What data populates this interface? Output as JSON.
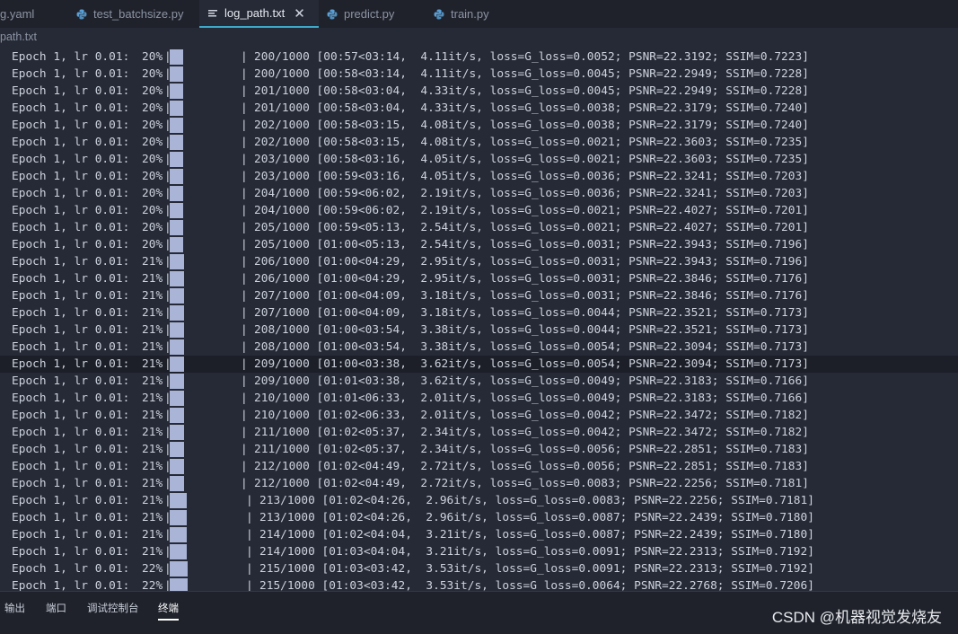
{
  "tabs": [
    {
      "label": "g.yaml",
      "icon": "none",
      "active": false
    },
    {
      "label": "test_batchsize.py",
      "icon": "python-icon",
      "active": false
    },
    {
      "label": "log_path.txt",
      "icon": "text-file-icon",
      "active": true
    },
    {
      "label": "predict.py",
      "icon": "python-icon",
      "active": false
    },
    {
      "label": "train.py",
      "icon": "python-icon",
      "active": false
    }
  ],
  "breadcrumb": "path.txt",
  "log_lines": [
    {
      "prefix": "Epoch 1, lr 0.01:",
      "pct": "20%",
      "progress": 0.2,
      "rest": "200/1000 [00:57<03:14,  4.11it/s, loss=G_loss=0.0052; PSNR=22.3192; SSIM=0.7223]"
    },
    {
      "prefix": "Epoch 1, lr 0.01:",
      "pct": "20%",
      "progress": 0.2,
      "rest": "200/1000 [00:58<03:14,  4.11it/s, loss=G_loss=0.0045; PSNR=22.2949; SSIM=0.7228]"
    },
    {
      "prefix": "Epoch 1, lr 0.01:",
      "pct": "20%",
      "progress": 0.2,
      "rest": "201/1000 [00:58<03:04,  4.33it/s, loss=G_loss=0.0045; PSNR=22.2949; SSIM=0.7228]"
    },
    {
      "prefix": "Epoch 1, lr 0.01:",
      "pct": "20%",
      "progress": 0.2,
      "rest": "201/1000 [00:58<03:04,  4.33it/s, loss=G_loss=0.0038; PSNR=22.3179; SSIM=0.7240]"
    },
    {
      "prefix": "Epoch 1, lr 0.01:",
      "pct": "20%",
      "progress": 0.2,
      "rest": "202/1000 [00:58<03:15,  4.08it/s, loss=G_loss=0.0038; PSNR=22.3179; SSIM=0.7240]"
    },
    {
      "prefix": "Epoch 1, lr 0.01:",
      "pct": "20%",
      "progress": 0.2,
      "rest": "202/1000 [00:58<03:15,  4.08it/s, loss=G_loss=0.0021; PSNR=22.3603; SSIM=0.7235]"
    },
    {
      "prefix": "Epoch 1, lr 0.01:",
      "pct": "20%",
      "progress": 0.2,
      "rest": "203/1000 [00:58<03:16,  4.05it/s, loss=G_loss=0.0021; PSNR=22.3603; SSIM=0.7235]"
    },
    {
      "prefix": "Epoch 1, lr 0.01:",
      "pct": "20%",
      "progress": 0.2,
      "rest": "203/1000 [00:59<03:16,  4.05it/s, loss=G_loss=0.0036; PSNR=22.3241; SSIM=0.7203]"
    },
    {
      "prefix": "Epoch 1, lr 0.01:",
      "pct": "20%",
      "progress": 0.2,
      "rest": "204/1000 [00:59<06:02,  2.19it/s, loss=G_loss=0.0036; PSNR=22.3241; SSIM=0.7203]"
    },
    {
      "prefix": "Epoch 1, lr 0.01:",
      "pct": "20%",
      "progress": 0.2,
      "rest": "204/1000 [00:59<06:02,  2.19it/s, loss=G_loss=0.0021; PSNR=22.4027; SSIM=0.7201]"
    },
    {
      "prefix": "Epoch 1, lr 0.01:",
      "pct": "20%",
      "progress": 0.2,
      "rest": "205/1000 [00:59<05:13,  2.54it/s, loss=G_loss=0.0021; PSNR=22.4027; SSIM=0.7201]"
    },
    {
      "prefix": "Epoch 1, lr 0.01:",
      "pct": "20%",
      "progress": 0.2,
      "rest": "205/1000 [01:00<05:13,  2.54it/s, loss=G_loss=0.0031; PSNR=22.3943; SSIM=0.7196]"
    },
    {
      "prefix": "Epoch 1, lr 0.01:",
      "pct": "21%",
      "progress": 0.21,
      "rest": "206/1000 [01:00<04:29,  2.95it/s, loss=G_loss=0.0031; PSNR=22.3943; SSIM=0.7196]"
    },
    {
      "prefix": "Epoch 1, lr 0.01:",
      "pct": "21%",
      "progress": 0.21,
      "rest": "206/1000 [01:00<04:29,  2.95it/s, loss=G_loss=0.0031; PSNR=22.3846; SSIM=0.7176]"
    },
    {
      "prefix": "Epoch 1, lr 0.01:",
      "pct": "21%",
      "progress": 0.21,
      "rest": "207/1000 [01:00<04:09,  3.18it/s, loss=G_loss=0.0031; PSNR=22.3846; SSIM=0.7176]"
    },
    {
      "prefix": "Epoch 1, lr 0.01:",
      "pct": "21%",
      "progress": 0.21,
      "rest": "207/1000 [01:00<04:09,  3.18it/s, loss=G_loss=0.0044; PSNR=22.3521; SSIM=0.7173]"
    },
    {
      "prefix": "Epoch 1, lr 0.01:",
      "pct": "21%",
      "progress": 0.21,
      "rest": "208/1000 [01:00<03:54,  3.38it/s, loss=G_loss=0.0044; PSNR=22.3521; SSIM=0.7173]"
    },
    {
      "prefix": "Epoch 1, lr 0.01:",
      "pct": "21%",
      "progress": 0.21,
      "rest": "208/1000 [01:00<03:54,  3.38it/s, loss=G_loss=0.0054; PSNR=22.3094; SSIM=0.7173]"
    },
    {
      "prefix": "Epoch 1, lr 0.01:",
      "pct": "21%",
      "progress": 0.21,
      "rest": "209/1000 [01:00<03:38,  3.62it/s, loss=G_loss=0.0054; PSNR=22.3094; SSIM=0.7173]",
      "current": true
    },
    {
      "prefix": "Epoch 1, lr 0.01:",
      "pct": "21%",
      "progress": 0.21,
      "rest": "209/1000 [01:01<03:38,  3.62it/s, loss=G_loss=0.0049; PSNR=22.3183; SSIM=0.7166]"
    },
    {
      "prefix": "Epoch 1, lr 0.01:",
      "pct": "21%",
      "progress": 0.21,
      "rest": "210/1000 [01:01<06:33,  2.01it/s, loss=G_loss=0.0049; PSNR=22.3183; SSIM=0.7166]"
    },
    {
      "prefix": "Epoch 1, lr 0.01:",
      "pct": "21%",
      "progress": 0.21,
      "rest": "210/1000 [01:02<06:33,  2.01it/s, loss=G_loss=0.0042; PSNR=22.3472; SSIM=0.7182]"
    },
    {
      "prefix": "Epoch 1, lr 0.01:",
      "pct": "21%",
      "progress": 0.21,
      "rest": "211/1000 [01:02<05:37,  2.34it/s, loss=G_loss=0.0042; PSNR=22.3472; SSIM=0.7182]"
    },
    {
      "prefix": "Epoch 1, lr 0.01:",
      "pct": "21%",
      "progress": 0.21,
      "rest": "211/1000 [01:02<05:37,  2.34it/s, loss=G_loss=0.0056; PSNR=22.2851; SSIM=0.7183]"
    },
    {
      "prefix": "Epoch 1, lr 0.01:",
      "pct": "21%",
      "progress": 0.21,
      "rest": "212/1000 [01:02<04:49,  2.72it/s, loss=G_loss=0.0056; PSNR=22.2851; SSIM=0.7183]"
    },
    {
      "prefix": "Epoch 1, lr 0.01:",
      "pct": "21%",
      "progress": 0.21,
      "rest": "212/1000 [01:02<04:49,  2.72it/s, loss=G_loss=0.0083; PSNR=22.2256; SSIM=0.7181]"
    },
    {
      "prefix": "Epoch 1, lr 0.01:",
      "pct": "21%",
      "progress": 0.21,
      "rest": "213/1000 [01:02<04:26,  2.96it/s, loss=G_loss=0.0083; PSNR=22.2256; SSIM=0.7181]",
      "wide": true
    },
    {
      "prefix": "Epoch 1, lr 0.01:",
      "pct": "21%",
      "progress": 0.21,
      "rest": "213/1000 [01:02<04:26,  2.96it/s, loss=G_loss=0.0087; PSNR=22.2439; SSIM=0.7180]",
      "wide": true
    },
    {
      "prefix": "Epoch 1, lr 0.01:",
      "pct": "21%",
      "progress": 0.21,
      "rest": "214/1000 [01:02<04:04,  3.21it/s, loss=G_loss=0.0087; PSNR=22.2439; SSIM=0.7180]",
      "wide": true
    },
    {
      "prefix": "Epoch 1, lr 0.01:",
      "pct": "21%",
      "progress": 0.21,
      "rest": "214/1000 [01:03<04:04,  3.21it/s, loss=G_loss=0.0091; PSNR=22.2313; SSIM=0.7192]",
      "wide": true
    },
    {
      "prefix": "Epoch 1, lr 0.01:",
      "pct": "22%",
      "progress": 0.22,
      "rest": "215/1000 [01:03<03:42,  3.53it/s, loss=G_loss=0.0091; PSNR=22.2313; SSIM=0.7192]",
      "wide": true
    },
    {
      "prefix": "Epoch 1, lr 0.01:",
      "pct": "22%",
      "progress": 0.22,
      "rest": "215/1000 [01:03<03:42,  3.53it/s, loss=G_loss=0.0064; PSNR=22.2768; SSIM=0.7206]",
      "wide": true
    }
  ],
  "panel": {
    "tabs": [
      {
        "label": "输出",
        "active": false
      },
      {
        "label": "端口",
        "active": false
      },
      {
        "label": "调试控制台",
        "active": false
      },
      {
        "label": "终端",
        "active": true
      }
    ]
  },
  "watermark": "CSDN @机器视觉发烧友",
  "colors": {
    "background": "#262a36",
    "bar": "#a9b4d6",
    "active_tab_accent": "#3ea8c9"
  }
}
